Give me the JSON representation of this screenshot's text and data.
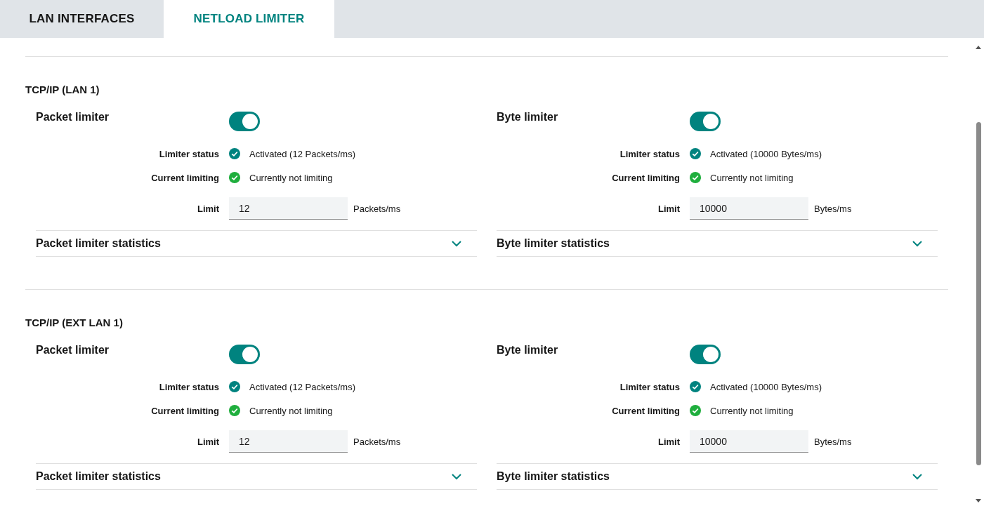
{
  "tabs": [
    {
      "label": "LAN INTERFACES",
      "selected": false
    },
    {
      "label": "NETLOAD LIMITER",
      "selected": true
    }
  ],
  "sections": [
    {
      "title": "TCP/IP (LAN 1)",
      "limiters": [
        {
          "title": "Packet limiter",
          "on": true,
          "status": [
            {
              "label": "Limiter status",
              "value": "Activated (12 Packets/ms)",
              "color": "#00837f"
            },
            {
              "label": "Current limiting",
              "value": "Currently not limiting",
              "color": "#1fae3d"
            }
          ],
          "limit_label": "Limit",
          "limit_value": "12",
          "unit": "Packets/ms",
          "statistics": {
            "label": "Packet limiter statistics",
            "expanded": false
          }
        },
        {
          "title": "Byte limiter",
          "on": true,
          "status": [
            {
              "label": "Limiter status",
              "value": "Activated (10000 Bytes/ms)",
              "color": "#00837f"
            },
            {
              "label": "Current limiting",
              "value": "Currently not limiting",
              "color": "#1fae3d"
            }
          ],
          "limit_label": "Limit",
          "limit_value": "10000",
          "unit": "Bytes/ms",
          "statistics": {
            "label": "Byte limiter statistics",
            "expanded": false
          }
        }
      ]
    },
    {
      "title": "TCP/IP (EXT LAN 1)",
      "limiters": [
        {
          "title": "Packet limiter",
          "on": true,
          "status": [
            {
              "label": "Limiter status",
              "value": "Activated (12 Packets/ms)",
              "color": "#00837f"
            },
            {
              "label": "Current limiting",
              "value": "Currently not limiting",
              "color": "#1fae3d"
            }
          ],
          "limit_label": "Limit",
          "limit_value": "12",
          "unit": "Packets/ms",
          "statistics": {
            "label": "Packet limiter statistics",
            "expanded": false
          }
        },
        {
          "title": "Byte limiter",
          "on": true,
          "status": [
            {
              "label": "Limiter status",
              "value": "Activated (10000 Bytes/ms)",
              "color": "#00837f"
            },
            {
              "label": "Current limiting",
              "value": "Currently not limiting",
              "color": "#1fae3d"
            }
          ],
          "limit_label": "Limit",
          "limit_value": "10000",
          "unit": "Bytes/ms",
          "statistics": {
            "label": "Byte limiter statistics",
            "expanded": false
          }
        }
      ]
    }
  ]
}
